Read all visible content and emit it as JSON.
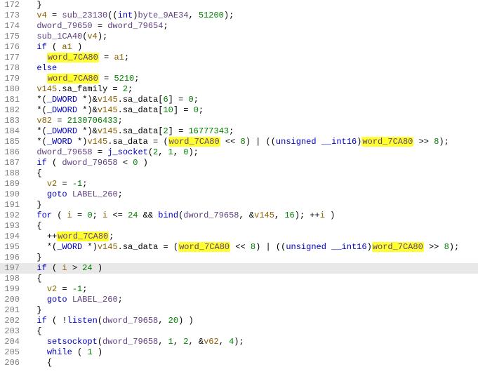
{
  "highlight_token": "word_7CA80",
  "current_line": 197,
  "lines": [
    {
      "n": 172,
      "indent": 1,
      "tokens": [
        {
          "t": "}",
          "c": "op"
        }
      ]
    },
    {
      "n": 173,
      "indent": 1,
      "tokens": [
        {
          "t": "v4",
          "c": "lvar"
        },
        {
          "t": " = ",
          "c": "op"
        },
        {
          "t": "sub_23130",
          "c": "gvar"
        },
        {
          "t": "((",
          "c": "op"
        },
        {
          "t": "int",
          "c": "typ"
        },
        {
          "t": ")",
          "c": "op"
        },
        {
          "t": "byte_9AE34",
          "c": "gvar"
        },
        {
          "t": ", ",
          "c": "op"
        },
        {
          "t": "51200",
          "c": "num"
        },
        {
          "t": ");",
          "c": "op"
        }
      ]
    },
    {
      "n": 174,
      "indent": 1,
      "tokens": [
        {
          "t": "dword_79650",
          "c": "gvar"
        },
        {
          "t": " = ",
          "c": "op"
        },
        {
          "t": "dword_79654",
          "c": "gvar"
        },
        {
          "t": ";",
          "c": "op"
        }
      ]
    },
    {
      "n": 175,
      "indent": 1,
      "tokens": [
        {
          "t": "sub_1CA40",
          "c": "gvar"
        },
        {
          "t": "(",
          "c": "op"
        },
        {
          "t": "v4",
          "c": "lvar"
        },
        {
          "t": ");",
          "c": "op"
        }
      ]
    },
    {
      "n": 176,
      "indent": 1,
      "tokens": [
        {
          "t": "if",
          "c": "kw"
        },
        {
          "t": " ( ",
          "c": "op"
        },
        {
          "t": "a1",
          "c": "lvar"
        },
        {
          "t": " )",
          "c": "op"
        }
      ]
    },
    {
      "n": 177,
      "indent": 2,
      "tokens": [
        {
          "t": "word_7CA80",
          "c": "gvar",
          "hl": true
        },
        {
          "t": " = ",
          "c": "op"
        },
        {
          "t": "a1",
          "c": "lvar"
        },
        {
          "t": ";",
          "c": "op"
        }
      ]
    },
    {
      "n": 178,
      "indent": 1,
      "tokens": [
        {
          "t": "else",
          "c": "kw"
        }
      ]
    },
    {
      "n": 179,
      "indent": 2,
      "tokens": [
        {
          "t": "word_7CA80",
          "c": "gvar",
          "hl": true
        },
        {
          "t": " = ",
          "c": "op"
        },
        {
          "t": "5210",
          "c": "num"
        },
        {
          "t": ";",
          "c": "op"
        }
      ]
    },
    {
      "n": 180,
      "indent": 1,
      "tokens": [
        {
          "t": "v145",
          "c": "lvar"
        },
        {
          "t": ".sa_family = ",
          "c": "op"
        },
        {
          "t": "2",
          "c": "num"
        },
        {
          "t": ";",
          "c": "op"
        }
      ]
    },
    {
      "n": 181,
      "indent": 1,
      "tokens": [
        {
          "t": "*(",
          "c": "op"
        },
        {
          "t": "_DWORD",
          "c": "typ"
        },
        {
          "t": " *)&",
          "c": "op"
        },
        {
          "t": "v145",
          "c": "lvar"
        },
        {
          "t": ".sa_data[",
          "c": "op"
        },
        {
          "t": "6",
          "c": "num"
        },
        {
          "t": "] = ",
          "c": "op"
        },
        {
          "t": "0",
          "c": "num"
        },
        {
          "t": ";",
          "c": "op"
        }
      ]
    },
    {
      "n": 182,
      "indent": 1,
      "tokens": [
        {
          "t": "*(",
          "c": "op"
        },
        {
          "t": "_DWORD",
          "c": "typ"
        },
        {
          "t": " *)&",
          "c": "op"
        },
        {
          "t": "v145",
          "c": "lvar"
        },
        {
          "t": ".sa_data[",
          "c": "op"
        },
        {
          "t": "10",
          "c": "num"
        },
        {
          "t": "] = ",
          "c": "op"
        },
        {
          "t": "0",
          "c": "num"
        },
        {
          "t": ";",
          "c": "op"
        }
      ]
    },
    {
      "n": 183,
      "indent": 1,
      "tokens": [
        {
          "t": "v82",
          "c": "lvar"
        },
        {
          "t": " = ",
          "c": "op"
        },
        {
          "t": "2130706433",
          "c": "num"
        },
        {
          "t": ";",
          "c": "op"
        }
      ]
    },
    {
      "n": 184,
      "indent": 1,
      "tokens": [
        {
          "t": "*(",
          "c": "op"
        },
        {
          "t": "_DWORD",
          "c": "typ"
        },
        {
          "t": " *)&",
          "c": "op"
        },
        {
          "t": "v145",
          "c": "lvar"
        },
        {
          "t": ".sa_data[",
          "c": "op"
        },
        {
          "t": "2",
          "c": "num"
        },
        {
          "t": "] = ",
          "c": "op"
        },
        {
          "t": "16777343",
          "c": "num"
        },
        {
          "t": ";",
          "c": "op"
        }
      ]
    },
    {
      "n": 185,
      "indent": 1,
      "tokens": [
        {
          "t": "*(",
          "c": "op"
        },
        {
          "t": "_WORD",
          "c": "typ"
        },
        {
          "t": " *)",
          "c": "op"
        },
        {
          "t": "v145",
          "c": "lvar"
        },
        {
          "t": ".sa_data = (",
          "c": "op"
        },
        {
          "t": "word_7CA80",
          "c": "gvar",
          "hl": true
        },
        {
          "t": " << ",
          "c": "op"
        },
        {
          "t": "8",
          "c": "num"
        },
        {
          "t": ") | ((",
          "c": "op"
        },
        {
          "t": "unsigned",
          "c": "typ"
        },
        {
          "t": " ",
          "c": "op"
        },
        {
          "t": "__int16",
          "c": "typ"
        },
        {
          "t": ")",
          "c": "op"
        },
        {
          "t": "word_7CA80",
          "c": "gvar",
          "hl": true
        },
        {
          "t": " >> ",
          "c": "op"
        },
        {
          "t": "8",
          "c": "num"
        },
        {
          "t": ");",
          "c": "op"
        }
      ]
    },
    {
      "n": 186,
      "indent": 1,
      "tokens": [
        {
          "t": "dword_79658",
          "c": "gvar"
        },
        {
          "t": " = ",
          "c": "op"
        },
        {
          "t": "j_socket",
          "c": "fn"
        },
        {
          "t": "(",
          "c": "op"
        },
        {
          "t": "2",
          "c": "num"
        },
        {
          "t": ", ",
          "c": "op"
        },
        {
          "t": "1",
          "c": "num"
        },
        {
          "t": ", ",
          "c": "op"
        },
        {
          "t": "0",
          "c": "num"
        },
        {
          "t": ");",
          "c": "op"
        }
      ]
    },
    {
      "n": 187,
      "indent": 1,
      "tokens": [
        {
          "t": "if",
          "c": "kw"
        },
        {
          "t": " ( ",
          "c": "op"
        },
        {
          "t": "dword_79658",
          "c": "gvar"
        },
        {
          "t": " < ",
          "c": "op"
        },
        {
          "t": "0",
          "c": "num"
        },
        {
          "t": " )",
          "c": "op"
        }
      ]
    },
    {
      "n": 188,
      "indent": 1,
      "tokens": [
        {
          "t": "{",
          "c": "op"
        }
      ]
    },
    {
      "n": 189,
      "indent": 2,
      "tokens": [
        {
          "t": "v2",
          "c": "lvar"
        },
        {
          "t": " = ",
          "c": "op"
        },
        {
          "t": "-1",
          "c": "num"
        },
        {
          "t": ";",
          "c": "op"
        }
      ]
    },
    {
      "n": 190,
      "indent": 2,
      "tokens": [
        {
          "t": "goto",
          "c": "kw"
        },
        {
          "t": " ",
          "c": "op"
        },
        {
          "t": "LABEL_260",
          "c": "gvar"
        },
        {
          "t": ";",
          "c": "op"
        }
      ]
    },
    {
      "n": 191,
      "indent": 1,
      "tokens": [
        {
          "t": "}",
          "c": "op"
        }
      ]
    },
    {
      "n": 192,
      "indent": 1,
      "tokens": [
        {
          "t": "for",
          "c": "kw"
        },
        {
          "t": " ( ",
          "c": "op"
        },
        {
          "t": "i",
          "c": "lvar"
        },
        {
          "t": " = ",
          "c": "op"
        },
        {
          "t": "0",
          "c": "num"
        },
        {
          "t": "; ",
          "c": "op"
        },
        {
          "t": "i",
          "c": "lvar"
        },
        {
          "t": " <= ",
          "c": "op"
        },
        {
          "t": "24",
          "c": "num"
        },
        {
          "t": " && ",
          "c": "op"
        },
        {
          "t": "bind",
          "c": "fn"
        },
        {
          "t": "(",
          "c": "op"
        },
        {
          "t": "dword_79658",
          "c": "gvar"
        },
        {
          "t": ", &",
          "c": "op"
        },
        {
          "t": "v145",
          "c": "lvar"
        },
        {
          "t": ", ",
          "c": "op"
        },
        {
          "t": "16",
          "c": "num"
        },
        {
          "t": "); ++",
          "c": "op"
        },
        {
          "t": "i",
          "c": "lvar"
        },
        {
          "t": " )",
          "c": "op"
        }
      ]
    },
    {
      "n": 193,
      "indent": 1,
      "tokens": [
        {
          "t": "{",
          "c": "op"
        }
      ]
    },
    {
      "n": 194,
      "indent": 2,
      "tokens": [
        {
          "t": "++",
          "c": "op"
        },
        {
          "t": "word_7CA80",
          "c": "gvar",
          "hl": true
        },
        {
          "t": ";",
          "c": "op"
        }
      ]
    },
    {
      "n": 195,
      "indent": 2,
      "tokens": [
        {
          "t": "*(",
          "c": "op"
        },
        {
          "t": "_WORD",
          "c": "typ"
        },
        {
          "t": " *)",
          "c": "op"
        },
        {
          "t": "v145",
          "c": "lvar"
        },
        {
          "t": ".sa_data = (",
          "c": "op"
        },
        {
          "t": "word_7CA80",
          "c": "gvar",
          "hl": true
        },
        {
          "t": " << ",
          "c": "op"
        },
        {
          "t": "8",
          "c": "num"
        },
        {
          "t": ") | ((",
          "c": "op"
        },
        {
          "t": "unsigned",
          "c": "typ"
        },
        {
          "t": " ",
          "c": "op"
        },
        {
          "t": "__int16",
          "c": "typ"
        },
        {
          "t": ")",
          "c": "op"
        },
        {
          "t": "word_7CA80",
          "c": "gvar",
          "hl": true
        },
        {
          "t": " >> ",
          "c": "op"
        },
        {
          "t": "8",
          "c": "num"
        },
        {
          "t": ");",
          "c": "op"
        }
      ]
    },
    {
      "n": 196,
      "indent": 1,
      "tokens": [
        {
          "t": "}",
          "c": "op"
        }
      ]
    },
    {
      "n": 197,
      "indent": 1,
      "current": true,
      "tokens": [
        {
          "t": "if",
          "c": "kw"
        },
        {
          "t": " ( ",
          "c": "op"
        },
        {
          "t": "i",
          "c": "lvar"
        },
        {
          "t": " > ",
          "c": "op"
        },
        {
          "t": "24",
          "c": "num"
        },
        {
          "t": " )",
          "c": "op"
        }
      ]
    },
    {
      "n": 198,
      "indent": 1,
      "tokens": [
        {
          "t": "{",
          "c": "op"
        }
      ]
    },
    {
      "n": 199,
      "indent": 2,
      "tokens": [
        {
          "t": "v2",
          "c": "lvar"
        },
        {
          "t": " = ",
          "c": "op"
        },
        {
          "t": "-1",
          "c": "num"
        },
        {
          "t": ";",
          "c": "op"
        }
      ]
    },
    {
      "n": 200,
      "indent": 2,
      "tokens": [
        {
          "t": "goto",
          "c": "kw"
        },
        {
          "t": " ",
          "c": "op"
        },
        {
          "t": "LABEL_260",
          "c": "gvar"
        },
        {
          "t": ";",
          "c": "op"
        }
      ]
    },
    {
      "n": 201,
      "indent": 1,
      "tokens": [
        {
          "t": "}",
          "c": "op"
        }
      ]
    },
    {
      "n": 202,
      "indent": 1,
      "tokens": [
        {
          "t": "if",
          "c": "kw"
        },
        {
          "t": " ( !",
          "c": "op"
        },
        {
          "t": "listen",
          "c": "fn"
        },
        {
          "t": "(",
          "c": "op"
        },
        {
          "t": "dword_79658",
          "c": "gvar"
        },
        {
          "t": ", ",
          "c": "op"
        },
        {
          "t": "20",
          "c": "num"
        },
        {
          "t": ") )",
          "c": "op"
        }
      ]
    },
    {
      "n": 203,
      "indent": 1,
      "tokens": [
        {
          "t": "{",
          "c": "op"
        }
      ]
    },
    {
      "n": 204,
      "indent": 2,
      "tokens": [
        {
          "t": "setsockopt",
          "c": "fn"
        },
        {
          "t": "(",
          "c": "op"
        },
        {
          "t": "dword_79658",
          "c": "gvar"
        },
        {
          "t": ", ",
          "c": "op"
        },
        {
          "t": "1",
          "c": "num"
        },
        {
          "t": ", ",
          "c": "op"
        },
        {
          "t": "2",
          "c": "num"
        },
        {
          "t": ", &",
          "c": "op"
        },
        {
          "t": "v62",
          "c": "lvar"
        },
        {
          "t": ", ",
          "c": "op"
        },
        {
          "t": "4",
          "c": "num"
        },
        {
          "t": ");",
          "c": "op"
        }
      ]
    },
    {
      "n": 205,
      "indent": 2,
      "tokens": [
        {
          "t": "while",
          "c": "kw"
        },
        {
          "t": " ( ",
          "c": "op"
        },
        {
          "t": "1",
          "c": "num"
        },
        {
          "t": " )",
          "c": "op"
        }
      ]
    },
    {
      "n": 206,
      "indent": 2,
      "tokens": [
        {
          "t": "{",
          "c": "op"
        }
      ]
    }
  ]
}
